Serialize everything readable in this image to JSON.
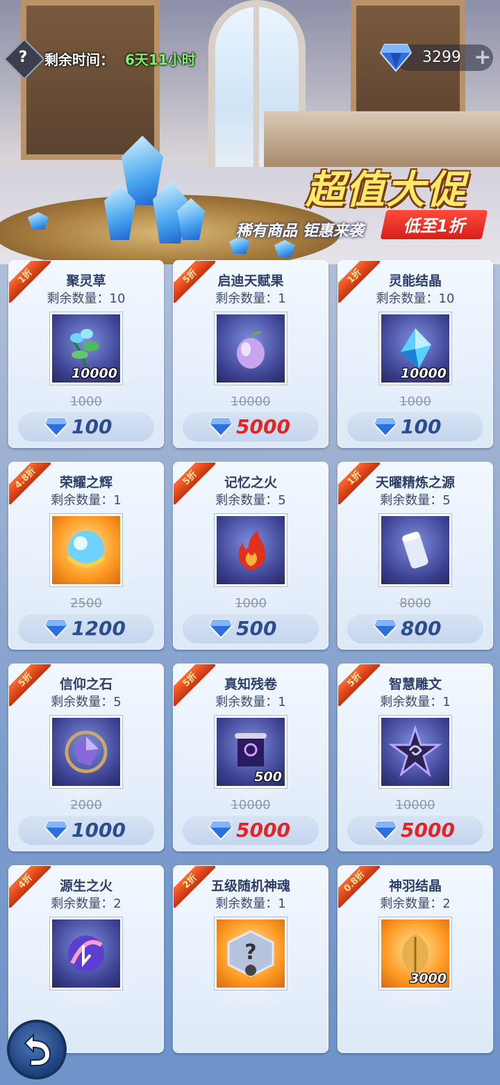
{
  "header": {
    "help_icon": "?",
    "time_label": "剩余时间：",
    "time_value": "6天11小时",
    "currency_icon": "diamond-icon",
    "currency_value": "3299",
    "add_label": "+"
  },
  "promo": {
    "title": "超值大促",
    "subtitle": "稀有商品 钜惠来袭",
    "badge": "低至1折"
  },
  "colors": {
    "price_red": "#e32425",
    "price_blue": "#2b4d8f",
    "stock_green": "#7cf26a",
    "ribbon": "#d2421a"
  },
  "items": [
    {
      "discount": "1折",
      "name": "聚灵草",
      "stock": "剩余数量：10",
      "qty": "10000",
      "orig": "1000",
      "price": "100",
      "red": false,
      "icon": "herb-icon"
    },
    {
      "discount": "5折",
      "name": "启迪天赋果",
      "stock": "剩余数量：1",
      "qty": "",
      "orig": "10000",
      "price": "5000",
      "red": true,
      "icon": "fruit-icon"
    },
    {
      "discount": "1折",
      "name": "灵能结晶",
      "stock": "剩余数量：10",
      "qty": "10000",
      "orig": "1000",
      "price": "100",
      "red": false,
      "icon": "crystal-icon"
    },
    {
      "discount": "4.8折",
      "name": "荣耀之辉",
      "stock": "剩余数量：1",
      "qty": "",
      "orig": "2500",
      "price": "1200",
      "red": false,
      "icon": "orb-icon"
    },
    {
      "discount": "5折",
      "name": "记忆之火",
      "stock": "剩余数量：5",
      "qty": "",
      "orig": "1000",
      "price": "500",
      "red": false,
      "icon": "flame-icon"
    },
    {
      "discount": "1折",
      "name": "天曜精炼之源",
      "stock": "剩余数量：5",
      "qty": "",
      "orig": "8000",
      "price": "800",
      "red": false,
      "icon": "cylinder-icon"
    },
    {
      "discount": "5折",
      "name": "信仰之石",
      "stock": "剩余数量：5",
      "qty": "",
      "orig": "2000",
      "price": "1000",
      "red": false,
      "icon": "stone-icon"
    },
    {
      "discount": "5折",
      "name": "真知残卷",
      "stock": "剩余数量：1",
      "qty": "500",
      "orig": "10000",
      "price": "5000",
      "red": true,
      "icon": "scroll-icon"
    },
    {
      "discount": "5折",
      "name": "智慧雕文",
      "stock": "剩余数量：1",
      "qty": "",
      "orig": "10000",
      "price": "5000",
      "red": true,
      "icon": "glyph-icon"
    },
    {
      "discount": "4折",
      "name": "源生之火",
      "stock": "剩余数量：2",
      "qty": "",
      "orig": "",
      "price": "",
      "red": false,
      "icon": "rune-fire-icon"
    },
    {
      "discount": "2折",
      "name": "五级随机神魂",
      "stock": "剩余数量：1",
      "qty": "",
      "orig": "",
      "price": "",
      "red": false,
      "icon": "random-soul-icon"
    },
    {
      "discount": "0.8折",
      "name": "神羽结晶",
      "stock": "剩余数量：2",
      "qty": "3000",
      "orig": "",
      "price": "",
      "red": false,
      "icon": "feather-icon"
    }
  ],
  "back_icon": "back-arrow-icon"
}
